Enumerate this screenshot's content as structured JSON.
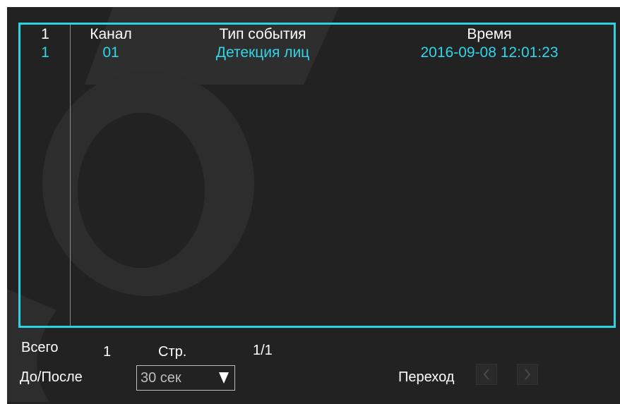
{
  "table": {
    "headers": [
      "1",
      "Канал",
      "Тип события",
      "Время"
    ],
    "rows": [
      {
        "index": "1",
        "channel": "01",
        "event_type": "Детекция лиц",
        "time": "2016-09-08 12:01:23"
      }
    ]
  },
  "footer": {
    "total_label": "Всего",
    "total_value": "1",
    "page_label": "Стр.",
    "page_value": "1/1",
    "pre_post_label": "До/После",
    "pre_post_value": "30 сек",
    "goto_label": "Переход"
  },
  "icons": {
    "dropdown": "triangle-down-icon",
    "prev": "chevron-left-icon",
    "next": "chevron-right-icon"
  },
  "colors": {
    "accent": "#29d3e4",
    "row_text": "#2fd6e8",
    "panel_bg": "#222222"
  }
}
